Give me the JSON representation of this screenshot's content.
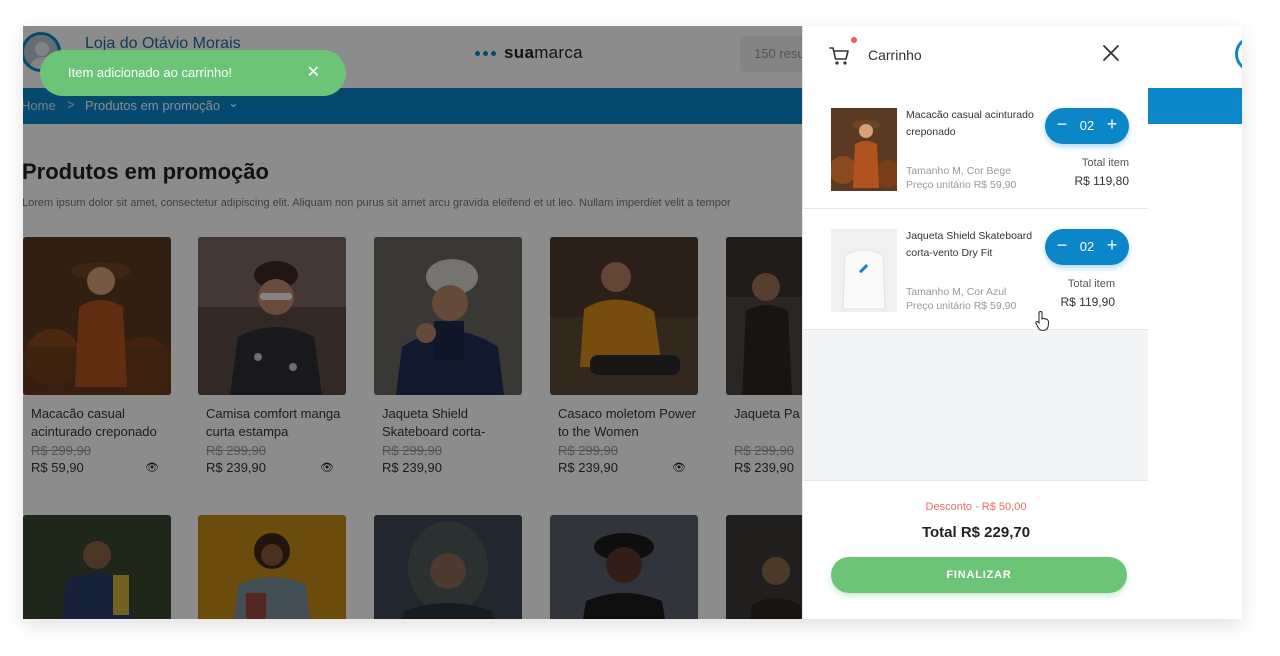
{
  "store": {
    "name": "Loja do Otávio Morais"
  },
  "brand": {
    "name_bold": "sua",
    "name_rest": "marca"
  },
  "search": {
    "text": "150 resu"
  },
  "breadcrumb": {
    "home": "Home",
    "separator": ">",
    "current": "Produtos em promoção",
    "caret": "⌄"
  },
  "page": {
    "title": "Produtos em promoção",
    "description": "Lorem ipsum dolor sit amet, consectetur adipiscing elit. Aliquam non purus sit amet arcu gravida eleifend et ut leo. Nullam imperdiet velit a tempor"
  },
  "products": [
    {
      "name": "Macacão casual acinturado creponado",
      "old_price": "R$ 299,90",
      "price": "R$ 59,90"
    },
    {
      "name": "Camisa comfort manga curta estampa",
      "old_price": "R$ 299,90",
      "price": "R$ 239,90"
    },
    {
      "name": "Jaqueta Shield Skateboard corta-",
      "old_price": "R$ 299,90",
      "price": "R$ 239,90"
    },
    {
      "name": "Casaco moletom Power to the Women",
      "old_price": "R$ 299,90",
      "price": "R$ 239,90"
    },
    {
      "name": "Jaqueta Pa sobretudo l",
      "old_price": "R$ 299,90",
      "price": "R$ 239,90"
    }
  ],
  "toast": {
    "message": "Item adicionado ao carrinho!",
    "close": "✕"
  },
  "cart": {
    "title": "Carrinho",
    "items": [
      {
        "name": "Macacão casual acinturado creponado",
        "variant": "Tamanho M, Cor Bege",
        "unit_price": "Preço unitário R$ 59,90",
        "qty": "02",
        "total_label": "Total item",
        "total_value": "R$ 119,80"
      },
      {
        "name": "Jaqueta Shield Skateboard corta-vento Dry Fit",
        "variant": "Tamanho M, Cor Azul",
        "unit_price": "Preço unitário R$ 59,90",
        "qty": "02",
        "total_label": "Total item",
        "total_value": "R$ 119,90"
      }
    ],
    "stepper": {
      "minus": "−",
      "plus": "+"
    },
    "discount": "Desconto - R$ 50,00",
    "total": "Total R$ 229,70",
    "finalize": "FINALIZAR"
  },
  "colors": {
    "primary_blue": "#0b86c8",
    "success_green": "#6cc477",
    "discount_red": "#ef6b6b"
  }
}
